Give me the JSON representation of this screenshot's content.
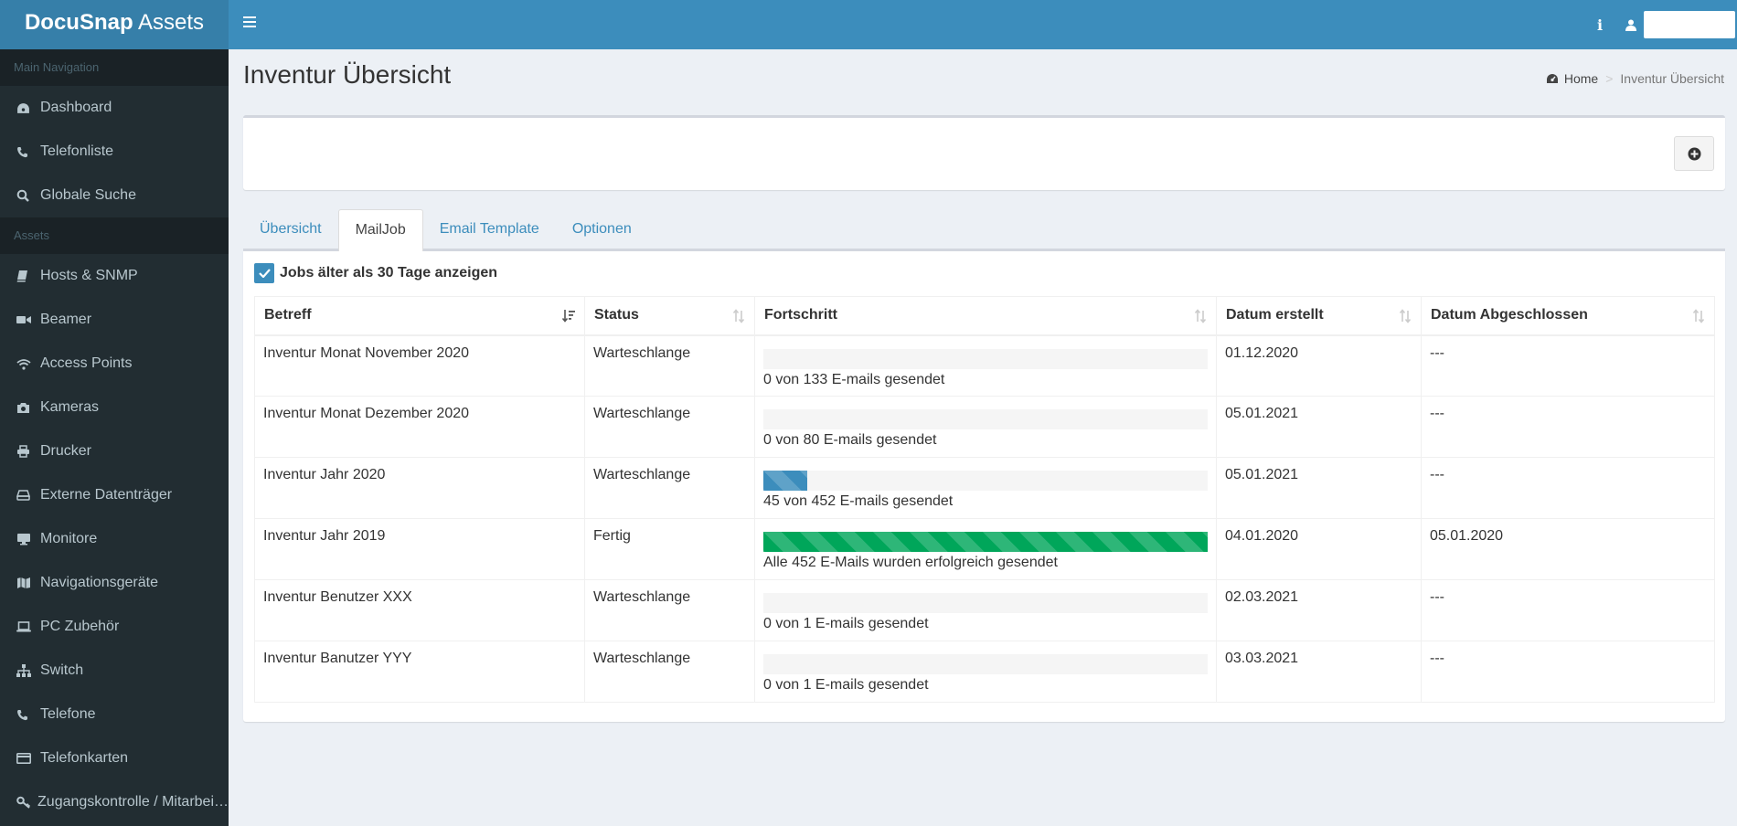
{
  "app": {
    "brand_bold": "DocuSnap",
    "brand_light": "Assets"
  },
  "header": {
    "info_icon": "info-icon",
    "user_icon": "user-icon"
  },
  "sidebar": {
    "sections": [
      {
        "title": "Main Navigation",
        "items": [
          {
            "label": "Dashboard",
            "icon": "dashboard-icon"
          },
          {
            "label": "Telefonliste",
            "icon": "phone-icon"
          },
          {
            "label": "Globale Suche",
            "icon": "search-icon"
          }
        ]
      },
      {
        "title": "Assets",
        "items": [
          {
            "label": "Hosts & SNMP",
            "icon": "book-icon"
          },
          {
            "label": "Beamer",
            "icon": "video-camera-icon"
          },
          {
            "label": "Access Points",
            "icon": "wifi-icon"
          },
          {
            "label": "Kameras",
            "icon": "camera-icon"
          },
          {
            "label": "Drucker",
            "icon": "printer-icon"
          },
          {
            "label": "Externe Datenträger",
            "icon": "hdd-icon"
          },
          {
            "label": "Monitore",
            "icon": "desktop-icon"
          },
          {
            "label": "Navigationsgeräte",
            "icon": "map-icon"
          },
          {
            "label": "PC Zubehör",
            "icon": "laptop-icon"
          },
          {
            "label": "Switch",
            "icon": "sitemap-icon"
          },
          {
            "label": "Telefone",
            "icon": "phone-icon"
          },
          {
            "label": "Telefonkarten",
            "icon": "credit-card-icon"
          },
          {
            "label": "Zugangskontrolle / Mitarbei…",
            "icon": "key-icon"
          }
        ]
      }
    ]
  },
  "page": {
    "title": "Inventur Übersicht"
  },
  "breadcrumb": {
    "home": "Home",
    "current": "Inventur Übersicht"
  },
  "tabs": [
    {
      "label": "Übersicht",
      "active": false
    },
    {
      "label": "MailJob",
      "active": true
    },
    {
      "label": "Email Template",
      "active": false
    },
    {
      "label": "Optionen",
      "active": false
    }
  ],
  "filter": {
    "label": "Jobs älter als 30 Tage anzeigen",
    "checked": true
  },
  "table": {
    "columns": [
      "Betreff",
      "Status",
      "Fortschritt",
      "Datum erstellt",
      "Datum Abgeschlossen"
    ],
    "rows": [
      {
        "betreff": "Inventur Monat November 2020",
        "status": "Warteschlange",
        "progress": 0,
        "progress_color": "#3c8dbc",
        "progress_text": "0 von 133 E-mails gesendet",
        "created": "01.12.2020",
        "completed": "---"
      },
      {
        "betreff": "Inventur Monat Dezember 2020",
        "status": "Warteschlange",
        "progress": 0,
        "progress_color": "#3c8dbc",
        "progress_text": "0 von 80 E-mails gesendet",
        "created": "05.01.2021",
        "completed": "---"
      },
      {
        "betreff": "Inventur Jahr 2020",
        "status": "Warteschlange",
        "progress": 0.0996,
        "progress_color": "#3c8dbc",
        "progress_text": "45 von 452 E-mails gesendet",
        "created": "05.01.2021",
        "completed": "---"
      },
      {
        "betreff": "Inventur Jahr 2019",
        "status": "Fertig",
        "progress": 1,
        "progress_color": "#00a65a",
        "progress_text": "Alle 452 E-Mails wurden erfolgreich gesendet",
        "created": "04.01.2020",
        "completed": "05.01.2020"
      },
      {
        "betreff": "Inventur Benutzer XXX",
        "status": "Warteschlange",
        "progress": 0,
        "progress_color": "#3c8dbc",
        "progress_text": "0 von 1 E-mails gesendet",
        "created": "02.03.2021",
        "completed": "---"
      },
      {
        "betreff": "Inventur Banutzer YYY",
        "status": "Warteschlange",
        "progress": 0,
        "progress_color": "#3c8dbc",
        "progress_text": "0 von 1 E-mails gesendet",
        "created": "03.03.2021",
        "completed": "---"
      }
    ]
  },
  "colors": {
    "primary": "#3c8dbc",
    "header_dark": "#367fa9",
    "sidebar": "#222d32",
    "success": "#00a65a"
  }
}
